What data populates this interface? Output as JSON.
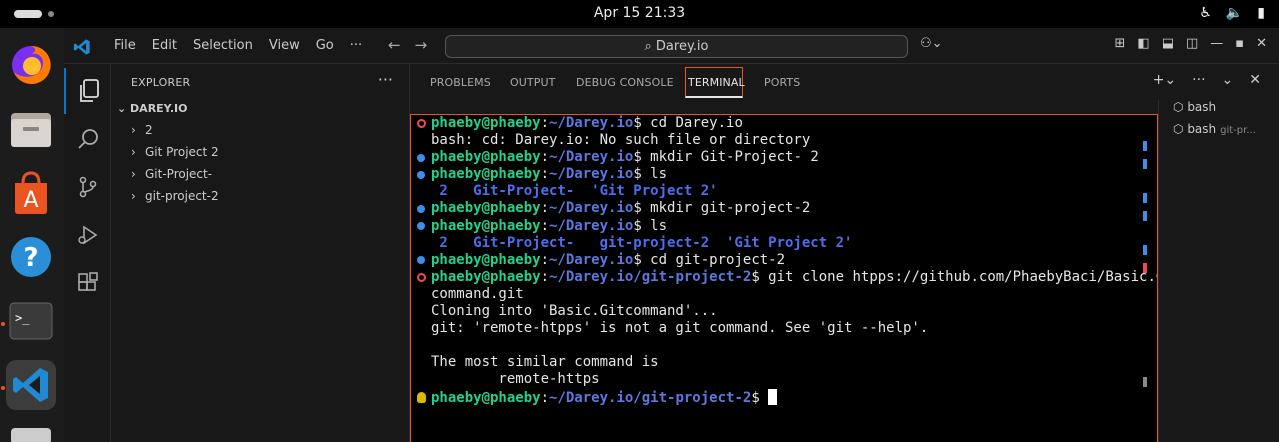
{
  "system": {
    "clock": "Apr 15  21:33"
  },
  "menu": [
    "File",
    "Edit",
    "Selection",
    "View",
    "Go",
    "···"
  ],
  "command_center": {
    "label": "Darey.io"
  },
  "explorer": {
    "header": "EXPLORER",
    "root": "DAREY.IO",
    "items": [
      "2",
      "Git Project 2",
      "Git-Project-",
      "git-project-2"
    ]
  },
  "panel": {
    "tabs": [
      "PROBLEMS",
      "OUTPUT",
      "DEBUG CONSOLE",
      "TERMINAL",
      "PORTS"
    ],
    "active_tab": "TERMINAL"
  },
  "terminal": {
    "user": "phaeby@phaeby",
    "lines": [
      {
        "mark": "err",
        "path": "~/Darey.io",
        "cmd": "cd Darey.io"
      },
      {
        "out": "bash: cd: Darey.io: No such file or directory"
      },
      {
        "mark": "dot",
        "path": "~/Darey.io",
        "cmd": "mkdir Git-Project- 2"
      },
      {
        "mark": "dot",
        "path": "~/Darey.io",
        "cmd": "ls"
      },
      {
        "ls": " 2   Git-Project-  'Git Project 2'"
      },
      {
        "mark": "dot",
        "path": "~/Darey.io",
        "cmd": "mkdir git-project-2"
      },
      {
        "mark": "dot",
        "path": "~/Darey.io",
        "cmd": "ls"
      },
      {
        "ls": " 2   Git-Project-   git-project-2  'Git Project 2'"
      },
      {
        "mark": "dot",
        "path": "~/Darey.io",
        "cmd": "cd git-project-2"
      },
      {
        "mark": "err",
        "path": "~/Darey.io/git-project-2",
        "cmd": "git clone htpps://github.com/PhaebyBaci/Basic.Git"
      },
      {
        "out": "command.git"
      },
      {
        "out": "Cloning into 'Basic.Gitcommand'..."
      },
      {
        "out": "git: 'remote-htpps' is not a git command. See 'git --help'."
      },
      {
        "out": ""
      },
      {
        "out": "The most similar command is"
      },
      {
        "out": "        remote-https"
      },
      {
        "mark": "bulb",
        "path": "~/Darey.io/git-project-2",
        "cmd": "",
        "cursor": true
      }
    ]
  },
  "terminal_list": [
    {
      "label": "bash",
      "detail": ""
    },
    {
      "label": "bash",
      "detail": "git-pr..."
    }
  ],
  "colors": {
    "accent": "#0078d4",
    "ubuntu_orange": "#e95420",
    "prompt_user": "#23d18b",
    "prompt_path": "#5c78e0"
  }
}
